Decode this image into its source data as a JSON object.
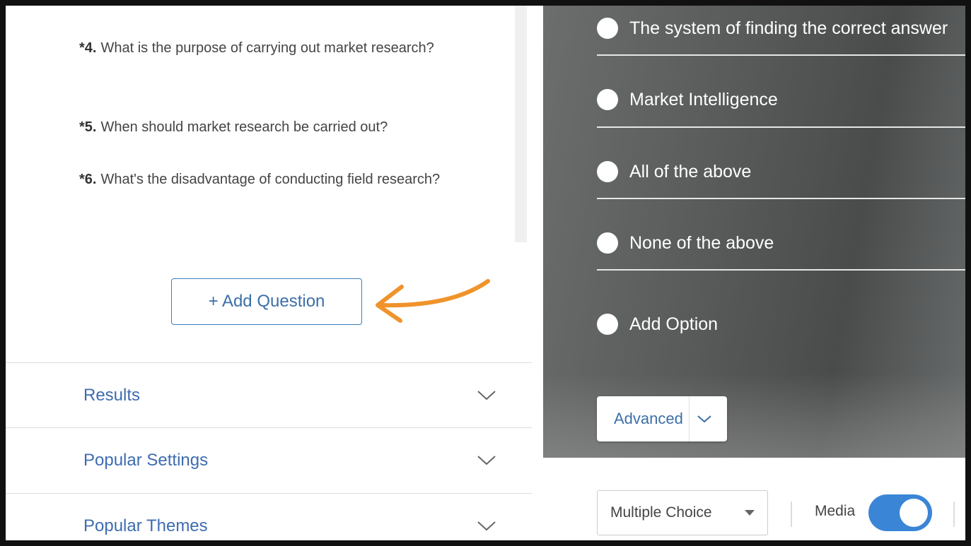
{
  "questions": [
    {
      "num": "*4.",
      "text": "What is the purpose of carrying out market research?"
    },
    {
      "num": "*5.",
      "text": "When should market research be carried out?"
    },
    {
      "num": "*6.",
      "text": "What's the disadvantage of conducting field research?"
    }
  ],
  "add_question_label": "+ Add Question",
  "sections": [
    {
      "label": "Results"
    },
    {
      "label": "Popular Settings"
    },
    {
      "label": "Popular Themes"
    }
  ],
  "options": [
    "The system of finding the correct answer",
    "Market Intelligence",
    "All of the above",
    "None of the above"
  ],
  "add_option_label": "Add Option",
  "advanced_label": "Advanced",
  "toolbar": {
    "question_type": "Multiple Choice",
    "media_label": "Media",
    "media_enabled": true
  },
  "colors": {
    "accent": "#3a85d6",
    "link": "#3e6cb0",
    "arrow": "#f0932b"
  }
}
